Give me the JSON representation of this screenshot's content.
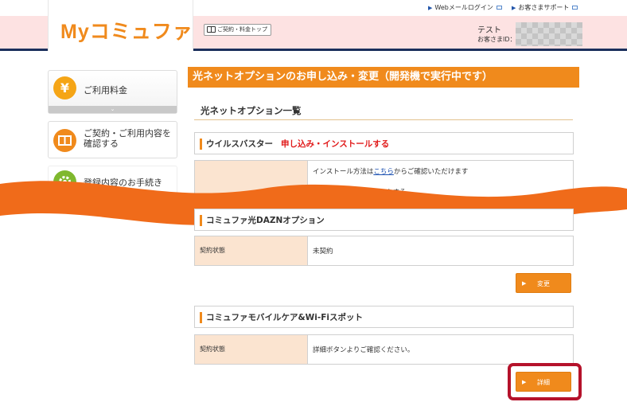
{
  "header": {
    "logo": "Myコミュファ",
    "links": [
      {
        "label": "Webメールログイン"
      },
      {
        "label": "お客さまサポート"
      }
    ],
    "contract_top": "ご契約・料金トップ",
    "user_name": "テスト",
    "user_id_label": "お客さまID："
  },
  "sidebar": {
    "items": [
      {
        "icon": "yen-icon",
        "icon_char": "¥",
        "label": "ご利用料金",
        "expand_char": "⌄"
      },
      {
        "icon": "book-icon",
        "label_lines": [
          "ご契約・ご利用内容を",
          "確認する"
        ]
      },
      {
        "icon": "gear-icon",
        "label": "登録内容のお手続き"
      }
    ]
  },
  "main": {
    "page_title": "光ネットオプションのお申し込み・変更（開発機で実行中です）",
    "list_heading": "光ネットオプション一覧",
    "sections": [
      {
        "title": "ウイルスバスター",
        "apply_link": "申し込み・インストールする",
        "rows": [
          {
            "value_pre": "インストール方法は",
            "value_link": "こちら",
            "value_post": "からご確認いただけます"
          },
          {
            "value_visible": "アル番号をクリックする"
          }
        ]
      },
      {
        "title": "コミュファ光DAZNオプション",
        "rows": [
          {
            "key": "契約状態",
            "value": "未契約"
          }
        ],
        "button": "変更"
      },
      {
        "title": "コミュファモバイルケア&Wi-Fiスポット",
        "rows": [
          {
            "key": "契約状態",
            "value": "詳細ボタンよりご確認ください。"
          }
        ],
        "button": "詳細"
      }
    ]
  },
  "colors": {
    "brand_orange": "#f08a1c",
    "header_pink": "#fde2e2",
    "header_rule": "#1b2f5c",
    "key_cell": "#fbe4d0",
    "apply_red": "#e11b1b",
    "highlight_red": "#b5122b"
  }
}
